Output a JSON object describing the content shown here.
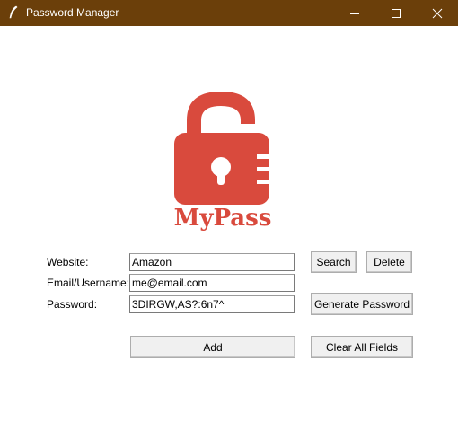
{
  "window": {
    "title": "Password Manager",
    "colors": {
      "titlebar": "#6b3f0a",
      "logo_red": "#d94a3d"
    }
  },
  "logo": {
    "text": "MyPass"
  },
  "form": {
    "website_label": "Website:",
    "website_value": "Amazon",
    "email_label": "Email/Username:",
    "email_value": "me@email.com",
    "password_label": "Password:",
    "password_value": "3DIRGW,AS?:6n7^"
  },
  "buttons": {
    "search": "Search",
    "delete": "Delete",
    "generate": "Generate Password",
    "add": "Add",
    "clear": "Clear All Fields"
  }
}
